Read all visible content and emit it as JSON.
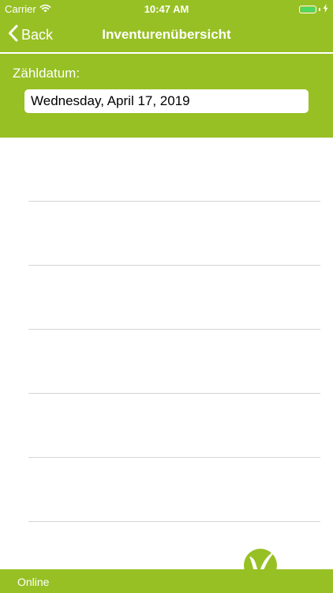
{
  "status_bar": {
    "carrier": "Carrier",
    "time": "10:47 AM"
  },
  "nav": {
    "back_label": "Back",
    "title": "Inventurenübersicht"
  },
  "date_panel": {
    "label": "Zähldatum:",
    "value": "Wednesday, April 17, 2019"
  },
  "footer": {
    "status": "Online"
  },
  "colors": {
    "accent": "#97c024",
    "battery": "#4cd964",
    "divider": "#d4d4d4"
  },
  "icons": {
    "wifi": "wifi-icon",
    "battery": "battery-icon",
    "charging": "charging-bolt-icon",
    "back": "chevron-left-icon",
    "logo": "brand-logo-v"
  }
}
